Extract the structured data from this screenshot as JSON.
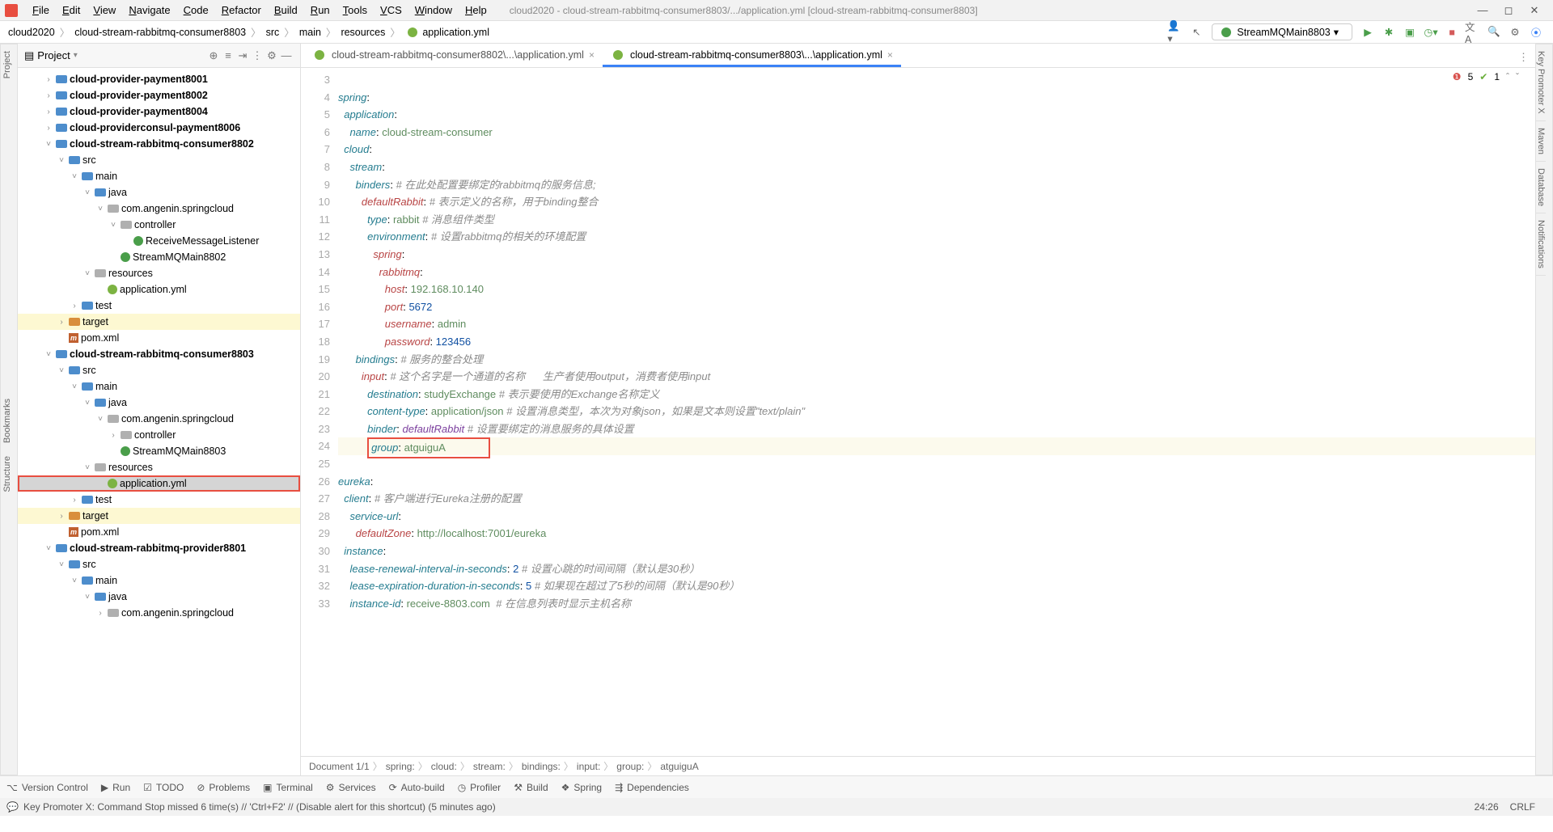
{
  "window": {
    "title": "cloud2020 - cloud-stream-rabbitmq-consumer8803/.../application.yml [cloud-stream-rabbitmq-consumer8803]"
  },
  "menu": [
    "File",
    "Edit",
    "View",
    "Navigate",
    "Code",
    "Refactor",
    "Build",
    "Run",
    "Tools",
    "VCS",
    "Window",
    "Help"
  ],
  "breadcrumbs": [
    "cloud2020",
    "cloud-stream-rabbitmq-consumer8803",
    "src",
    "main",
    "resources",
    "application.yml"
  ],
  "runConfig": "StreamMQMain8803",
  "leftStrip": [
    "Project",
    "Bookmarks",
    "Structure"
  ],
  "rightStrip": [
    "Key Promoter X",
    "Maven",
    "Database",
    "Notifications"
  ],
  "projectPanel": {
    "title": "Project",
    "tree": [
      {
        "d": 2,
        "tw": ">",
        "ic": "folder blue",
        "t": "cloud-provider-payment8001",
        "b": 1
      },
      {
        "d": 2,
        "tw": ">",
        "ic": "folder blue",
        "t": "cloud-provider-payment8002",
        "b": 1
      },
      {
        "d": 2,
        "tw": ">",
        "ic": "folder blue",
        "t": "cloud-provider-payment8004",
        "b": 1
      },
      {
        "d": 2,
        "tw": ">",
        "ic": "folder blue",
        "t": "cloud-providerconsul-payment8006",
        "b": 1
      },
      {
        "d": 2,
        "tw": "v",
        "ic": "folder blue",
        "t": "cloud-stream-rabbitmq-consumer8802",
        "b": 1
      },
      {
        "d": 3,
        "tw": "v",
        "ic": "folder blue",
        "t": "src"
      },
      {
        "d": 4,
        "tw": "v",
        "ic": "folder blue",
        "t": "main"
      },
      {
        "d": 5,
        "tw": "v",
        "ic": "folder blue",
        "t": "java"
      },
      {
        "d": 6,
        "tw": "v",
        "ic": "folder grey",
        "t": "com.angenin.springcloud"
      },
      {
        "d": 7,
        "tw": "v",
        "ic": "folder grey",
        "t": "controller"
      },
      {
        "d": 8,
        "tw": "",
        "ic": "cls",
        "t": "ReceiveMessageListener"
      },
      {
        "d": 7,
        "tw": "",
        "ic": "cls",
        "t": "StreamMQMain8802"
      },
      {
        "d": 5,
        "tw": "v",
        "ic": "folder grey",
        "t": "resources"
      },
      {
        "d": 6,
        "tw": "",
        "ic": "yaml",
        "t": "application.yml"
      },
      {
        "d": 4,
        "tw": ">",
        "ic": "folder blue",
        "t": "test"
      },
      {
        "d": 3,
        "tw": ">",
        "ic": "folder orng",
        "t": "target",
        "hl": "yl"
      },
      {
        "d": 3,
        "tw": "",
        "ic": "maven",
        "t": "pom.xml"
      },
      {
        "d": 2,
        "tw": "v",
        "ic": "folder blue",
        "t": "cloud-stream-rabbitmq-consumer8803",
        "b": 1
      },
      {
        "d": 3,
        "tw": "v",
        "ic": "folder blue",
        "t": "src"
      },
      {
        "d": 4,
        "tw": "v",
        "ic": "folder blue",
        "t": "main"
      },
      {
        "d": 5,
        "tw": "v",
        "ic": "folder blue",
        "t": "java"
      },
      {
        "d": 6,
        "tw": "v",
        "ic": "folder grey",
        "t": "com.angenin.springcloud"
      },
      {
        "d": 7,
        "tw": ">",
        "ic": "folder grey",
        "t": "controller"
      },
      {
        "d": 7,
        "tw": "",
        "ic": "cls",
        "t": "StreamMQMain8803"
      },
      {
        "d": 5,
        "tw": "v",
        "ic": "folder grey",
        "t": "resources"
      },
      {
        "d": 6,
        "tw": "",
        "ic": "yaml",
        "t": "application.yml",
        "sel": 1,
        "red": 1
      },
      {
        "d": 4,
        "tw": ">",
        "ic": "folder blue",
        "t": "test"
      },
      {
        "d": 3,
        "tw": ">",
        "ic": "folder orng",
        "t": "target",
        "hl": "yl"
      },
      {
        "d": 3,
        "tw": "",
        "ic": "maven",
        "t": "pom.xml"
      },
      {
        "d": 2,
        "tw": "v",
        "ic": "folder blue",
        "t": "cloud-stream-rabbitmq-provider8801",
        "b": 1
      },
      {
        "d": 3,
        "tw": "v",
        "ic": "folder blue",
        "t": "src"
      },
      {
        "d": 4,
        "tw": "v",
        "ic": "folder blue",
        "t": "main"
      },
      {
        "d": 5,
        "tw": "v",
        "ic": "folder blue",
        "t": "java"
      },
      {
        "d": 6,
        "tw": ">",
        "ic": "folder grey",
        "t": "com.angenin.springcloud"
      }
    ]
  },
  "tabs": [
    {
      "label": "cloud-stream-rabbitmq-consumer8802\\...\\application.yml",
      "active": false
    },
    {
      "label": "cloud-stream-rabbitmq-consumer8803\\...\\application.yml",
      "active": true
    }
  ],
  "indicators": {
    "errors": "5",
    "warnings": "1"
  },
  "code": {
    "start": 3,
    "lines": [
      "",
      "<span class='k-teal'>spring</span>:",
      "  <span class='k-teal'>application</span>:",
      "    <span class='k-teal'>name</span>: <span class='k-green-c'>cloud-stream-consumer</span>",
      "  <span class='k-teal'>cloud</span>:",
      "    <span class='k-teal'>stream</span>:",
      "      <span class='k-teal'>binders</span>: <span class='k-itgrey'># 在此处配置要绑定的rabbitmq的服务信息;</span>",
      "        <span class='k-red'>defaultRabbit</span>: <span class='k-itgrey'># 表示定义的名称，用于binding整合</span>",
      "          <span class='k-teal'>type</span>: <span class='k-green-c'>rabbit </span><span class='k-itgrey'># 消息组件类型</span>",
      "          <span class='k-teal'>environment</span>: <span class='k-itgrey'># 设置rabbitmq的相关的环境配置</span>",
      "            <span class='k-red'>spring</span>:",
      "              <span class='k-red'>rabbitmq</span>:",
      "                <span class='k-red'>host</span>: <span class='k-green-c'>192.168.10.140</span>",
      "                <span class='k-red'>port</span>: <span class='k-blue'>5672</span>",
      "                <span class='k-red'>username</span>: <span class='k-green-c'>admin</span>",
      "                <span class='k-red'>password</span>: <span class='k-blue'>123456</span>",
      "      <span class='k-teal'>bindings</span>: <span class='k-itgrey'># 服务的整合处理</span>",
      "        <span class='k-red'>input</span>: <span class='k-itgrey'># 这个名字是一个通道的名称      生产者使用output，消费者使用input</span>",
      "          <span class='k-teal'>destination</span>: <span class='k-green-c'>studyExchange </span><span class='k-itgrey'># 表示要使用的Exchange名称定义</span>",
      "          <span class='k-teal'>content-type</span>: <span class='k-green-c'>application/json </span><span class='k-itgrey'># 设置消息类型，本次为对象json，如果是文本则设置\"text/plain\"</span>",
      "          <span class='k-teal'>binder</span>: <span class='k-purple'>defaultRabbit</span> <span class='k-itgrey'># 设置要绑定的消息服务的具体设置</span>",
      "          <span class='redbox'><span class='k-teal'>group</span>: <span class='k-green-c'>atguiguA</span>              </span>",
      "",
      "<span class='k-teal'>eureka</span>:",
      "  <span class='k-teal'>client</span>: <span class='k-itgrey'># 客户端进行Eureka注册的配置</span>",
      "    <span class='k-teal'>service-url</span>:",
      "      <span class='k-red'>defaultZone</span>: <span class='k-green-c'>http://localhost:7001/eureka</span>",
      "  <span class='k-teal'>instance</span>:",
      "    <span class='k-teal'>lease-renewal-interval-in-seconds</span>: <span class='k-blue'>2</span> <span class='k-itgrey'># 设置心跳的时间间隔（默认是30秒）</span>",
      "    <span class='k-teal'>lease-expiration-duration-in-seconds</span>: <span class='k-blue'>5</span> <span class='k-itgrey'># 如果现在超过了5秒的间隔（默认是90秒）</span>",
      "    <span class='k-teal'>instance-id</span>: <span class='k-green-c'>receive-8803.com  </span><span class='k-itgrey'># 在信息列表时显示主机名称</span>"
    ]
  },
  "codeCrumbs": [
    "Document 1/1",
    "spring:",
    "cloud:",
    "stream:",
    "bindings:",
    "input:",
    "group:",
    "atguiguA"
  ],
  "bottomTools": [
    "Version Control",
    "Run",
    "TODO",
    "Problems",
    "Terminal",
    "Services",
    "Auto-build",
    "Profiler",
    "Build",
    "Spring",
    "Dependencies"
  ],
  "status": {
    "msg": "Key Promoter X: Command Stop missed 6 time(s) // 'Ctrl+F2' // (Disable alert for this shortcut) (5 minutes ago)",
    "pos": "24:26",
    "enc": "CRLF"
  }
}
